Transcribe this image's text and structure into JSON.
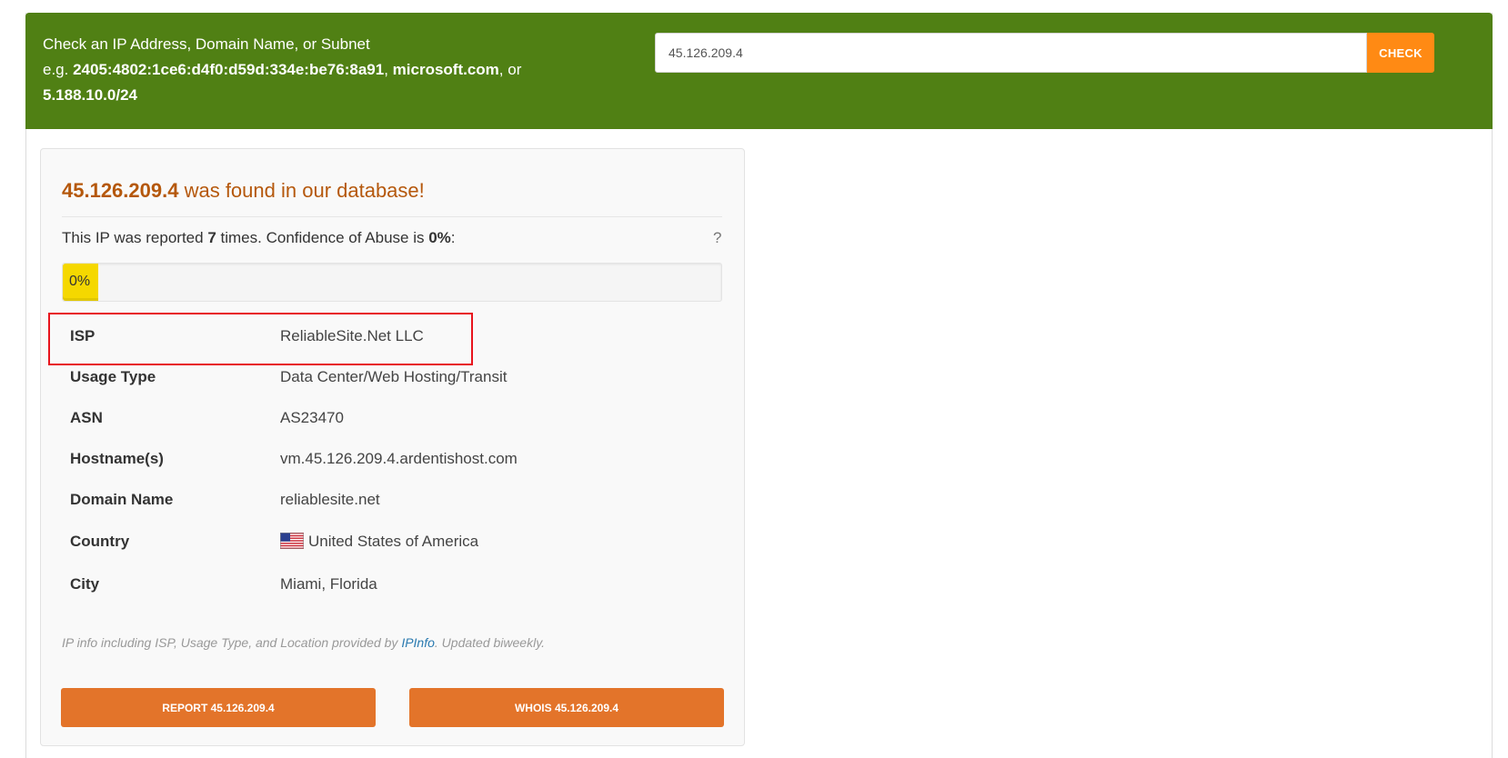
{
  "header": {
    "prompt": "Check an IP Address, Domain Name, or Subnet",
    "example_prefix": "e.g. ",
    "example_ipv6": "2405:4802:1ce6:d4f0:d59d:334e:be76:8a91",
    "example_sep": ", ",
    "example_domain": "microsoft.com",
    "example_or": ", or",
    "example_subnet": "5.188.10.0/24",
    "search_value": "45.126.209.4",
    "check_label": "CHECK"
  },
  "result": {
    "ip": "45.126.209.4",
    "found_suffix": " was found in our database!",
    "reported_prefix": "This IP was reported ",
    "reported_count": "7",
    "reported_mid": " times. Confidence of Abuse is ",
    "confidence_text": "0%",
    "reported_suffix": ":",
    "help": "?",
    "progress_label": "0%",
    "confidence_value": 0
  },
  "info": [
    {
      "label": "ISP",
      "value": "ReliableSite.Net LLC"
    },
    {
      "label": "Usage Type",
      "value": "Data Center/Web Hosting/Transit"
    },
    {
      "label": "ASN",
      "value": "AS23470"
    },
    {
      "label": "Hostname(s)",
      "value": "vm.45.126.209.4.ardentishost.com"
    },
    {
      "label": "Domain Name",
      "value": "reliablesite.net"
    },
    {
      "label": "Country",
      "value": "United States of America",
      "flag_icon": "us-flag-icon"
    },
    {
      "label": "City",
      "value": "Miami, Florida"
    }
  ],
  "footnote": {
    "prefix": "IP info including ISP, Usage Type, and Location provided by ",
    "link": "IPInfo",
    "suffix": ". Updated biweekly."
  },
  "buttons": {
    "report": "REPORT 45.126.209.4",
    "whois": "WHOIS 45.126.209.4"
  },
  "colors": {
    "header_bg": "#508014",
    "check_button": "#ff8a14",
    "action_button": "#e3742a",
    "title_color": "#b5580c",
    "progress_fill": "#f5d800",
    "highlight_border": "#e8141d"
  }
}
